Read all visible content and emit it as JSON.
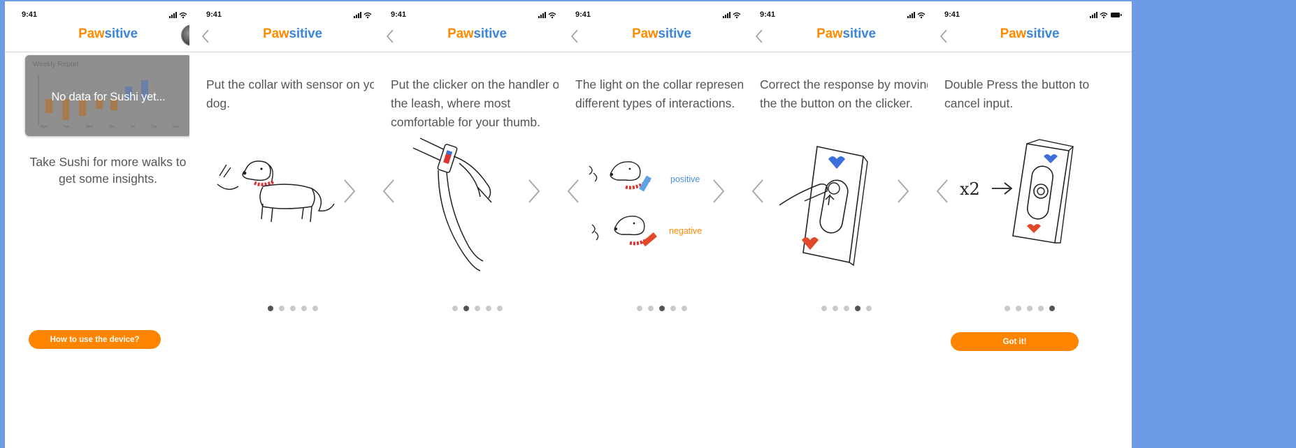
{
  "status_time": "9:41",
  "brand": {
    "part1": "Paw",
    "part2": "sitive"
  },
  "home": {
    "report_title": "Weekly Report",
    "report_message": "No data for Sushi yet...",
    "days": [
      "Mon",
      "Tue",
      "Wed",
      "Thu",
      "Fri",
      "Sat",
      "Sun"
    ],
    "cta_text": "Take Sushi for more walks to get some insights.",
    "button_label": "How to use the device?"
  },
  "steps": [
    {
      "text": "Put the collar with sensor on your dog."
    },
    {
      "text": "Put the clicker on the handler of the leash, where most comfortable for your thumb."
    },
    {
      "text": "The light on the collar represents different types of interactions.",
      "positive": "positive",
      "negative": "negative"
    },
    {
      "text": "Correct the response by moving the the button on the clicker."
    },
    {
      "text": "Double Press the button to cancel input.",
      "annotation": "x2",
      "button_label": "Got it!"
    }
  ],
  "colors": {
    "brand_orange": "#ff8a00",
    "brand_blue": "#3b86d9",
    "background": "#6e9be6"
  }
}
